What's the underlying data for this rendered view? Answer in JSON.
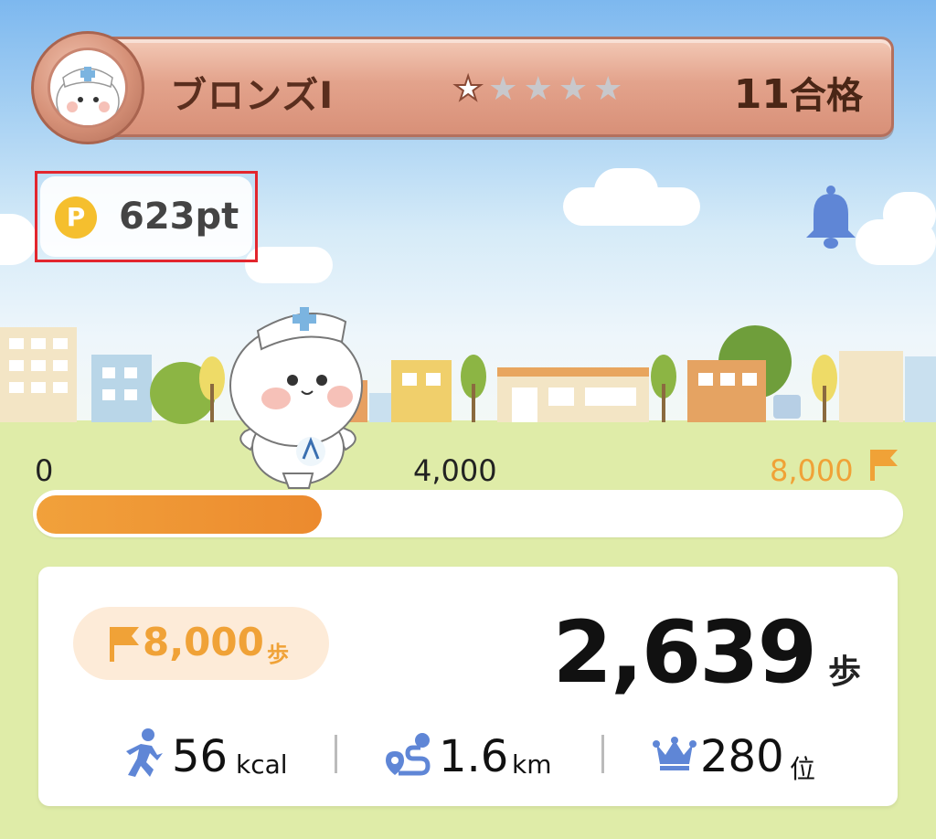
{
  "rank": {
    "name": "ブロンズⅠ",
    "stars_total": 5,
    "stars_filled": 1,
    "pass_count": "11",
    "pass_unit": "合格"
  },
  "points": {
    "coin_label": "P",
    "value": "623pt"
  },
  "progress": {
    "start_label": "0",
    "mid_label": "4,000",
    "goal_label": "8,000",
    "fraction": 0.33
  },
  "stats": {
    "goal_value": "8,000",
    "goal_unit": "歩",
    "steps_value": "2,639",
    "steps_unit": "歩",
    "calories_value": "56",
    "calories_unit": "kcal",
    "distance_value": "1.6",
    "distance_unit": "km",
    "ranking_value": "280",
    "ranking_unit": "位"
  },
  "icons": {
    "bell": "bell-icon",
    "coin": "points-coin-icon",
    "flag": "goal-flag-icon",
    "runner": "runner-icon",
    "route": "route-icon",
    "crown": "crown-icon"
  },
  "colors": {
    "accent_orange": "#f0a237",
    "bronze": "#d89078",
    "coin_yellow": "#f5bf2e",
    "icon_blue": "#5f86d6"
  }
}
